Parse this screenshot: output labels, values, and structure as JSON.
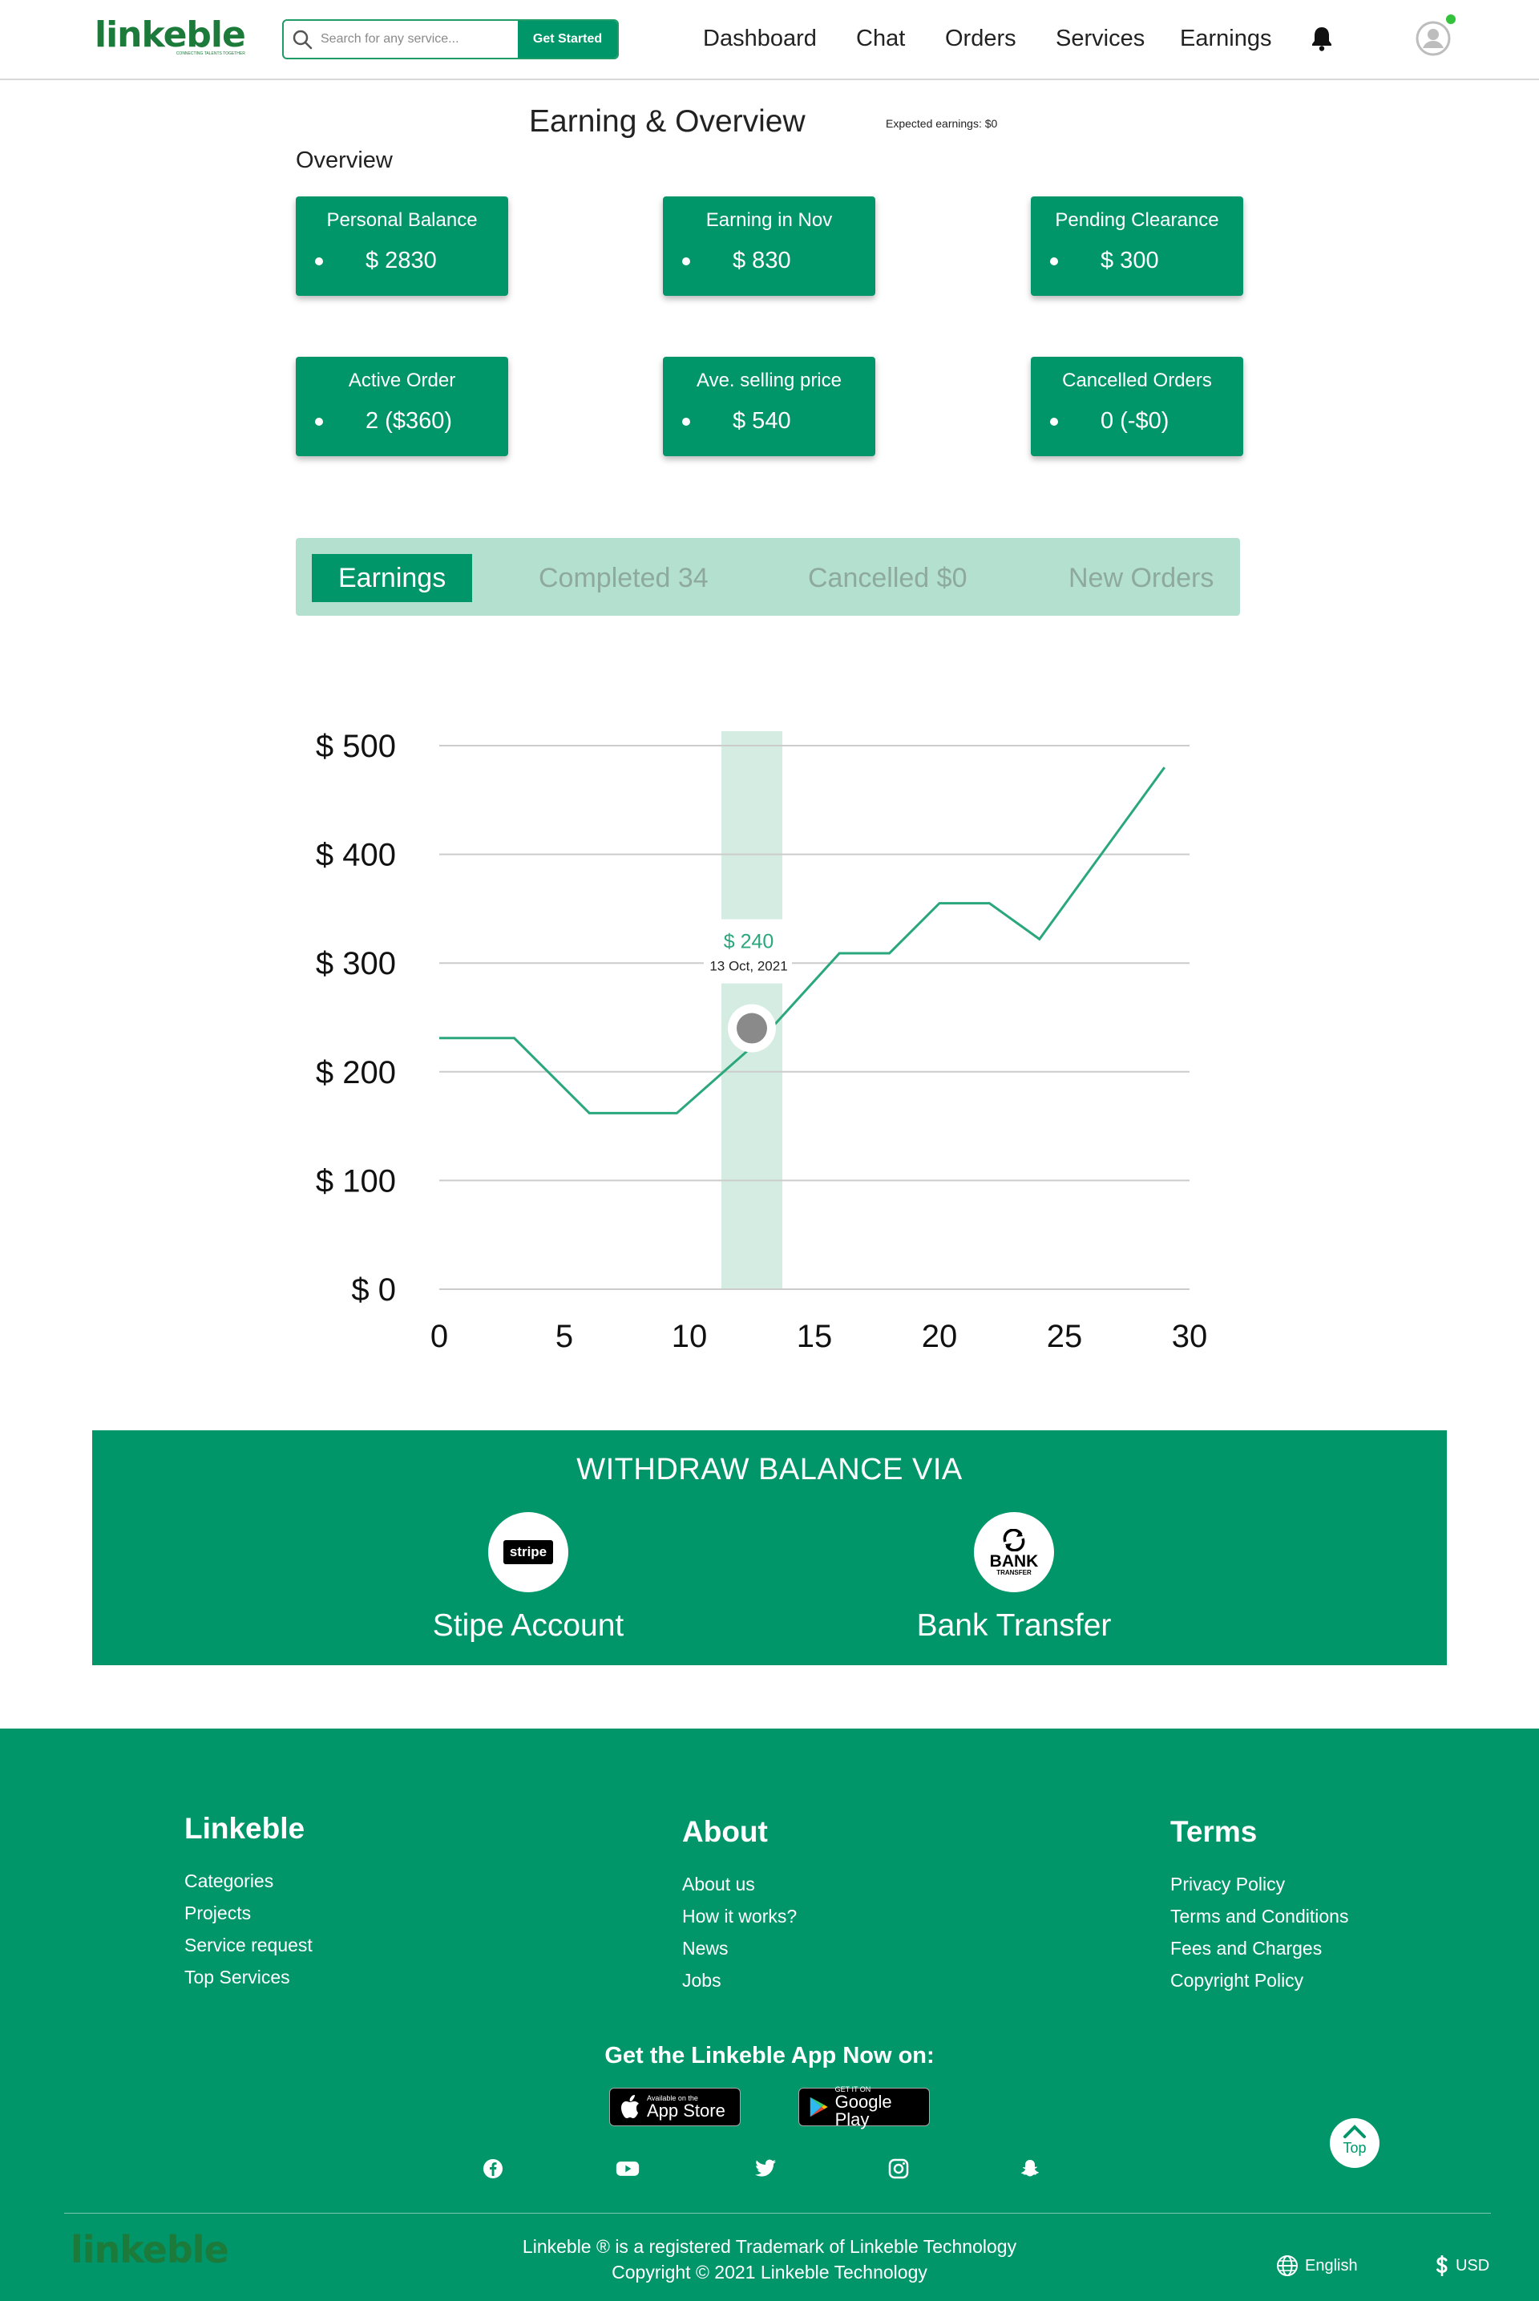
{
  "header": {
    "logo": "linkeble",
    "logo_tagline": "CONNECTING TALENTS TOGETHER",
    "search_placeholder": "Search for any service...",
    "get_started": "Get Started",
    "nav": [
      "Dashboard",
      "Chat",
      "Orders",
      "Services",
      "Earnings"
    ],
    "icons": {
      "search": "search-icon",
      "bell": "bell-icon",
      "avatar": "user-avatar-icon"
    },
    "online_color": "#33c23a"
  },
  "overview": {
    "title": "Earning & Overview",
    "expected_earnings": "Expected earnings: $0",
    "section_label": "Overview",
    "cards": [
      {
        "title": "Personal Balance",
        "value": "$ 2830"
      },
      {
        "title": "Earning in Nov",
        "value": "$ 830"
      },
      {
        "title": "Pending Clearance",
        "value": "$ 300"
      },
      {
        "title": "Active Order",
        "value": "2 ($360)"
      },
      {
        "title": "Ave. selling price",
        "value": "$ 540"
      },
      {
        "title": "Cancelled Orders",
        "value": "0 (-$0)"
      }
    ]
  },
  "tabs": [
    "Earnings",
    "Completed 34",
    "Cancelled $0",
    "New Orders"
  ],
  "chart_data": {
    "type": "line",
    "x": [
      0,
      3,
      6,
      9.5,
      13,
      16,
      18,
      20,
      22,
      24,
      29
    ],
    "y": [
      231,
      231,
      162,
      162,
      233,
      309,
      309,
      355,
      355,
      322,
      480
    ],
    "xlim": [
      0,
      30
    ],
    "ylim": [
      0,
      500
    ],
    "xticks": [
      "0",
      "5",
      "10",
      "15",
      "20",
      "25",
      "30"
    ],
    "yticks": [
      "$ 0",
      "$ 100",
      "$ 200",
      "$ 300",
      "$ 400",
      "$ 500"
    ],
    "grid": true,
    "highlight": {
      "x": 12.5,
      "y": 240,
      "value": "$ 240",
      "date": "13 Oct, 2021"
    },
    "colors": {
      "line": "#2aa77c",
      "band": "#d5ece3",
      "marker": "#8a8a8a",
      "grid": "#cccccc"
    }
  },
  "withdraw": {
    "title": "WITHDRAW BALANCE VIA",
    "methods": [
      {
        "label": "Stipe Account",
        "icon": "stripe-icon",
        "icon_text": "stripe"
      },
      {
        "label": "Bank Transfer",
        "icon": "bank-transfer-icon",
        "icon_text": "BANK",
        "icon_subtext": "TRANSFER"
      }
    ]
  },
  "footer": {
    "columns": [
      {
        "heading": "Linkeble",
        "links": [
          "Categories",
          "Projects",
          "Service request",
          "Top Services"
        ]
      },
      {
        "heading": "About",
        "links": [
          "About us",
          "How it works?",
          "News",
          "Jobs"
        ]
      },
      {
        "heading": "Terms",
        "links": [
          "Privacy Policy",
          "Terms and Conditions",
          "Fees and Charges",
          "Copyright Policy"
        ]
      }
    ],
    "app_heading": "Get the Linkeble App Now on:",
    "app_store": {
      "small": "Available on the",
      "big": "App Store"
    },
    "google_play": {
      "small": "GET IT ON",
      "big": "Google Play"
    },
    "socials": [
      "facebook-icon",
      "youtube-icon",
      "twitter-icon",
      "instagram-icon",
      "snapchat-icon"
    ],
    "top_label": "Top",
    "logo": "linkeble",
    "copyright_line1": "Linkeble ® is a registered Trademark of Linkeble Technology",
    "copyright_line2": "Copyright © 2021 Linkeble Technology",
    "language": "English",
    "currency": "USD"
  },
  "colors": {
    "brand": "#009669",
    "tabs_bg": "#b3e0cf",
    "logo": "#1c7a3a"
  }
}
